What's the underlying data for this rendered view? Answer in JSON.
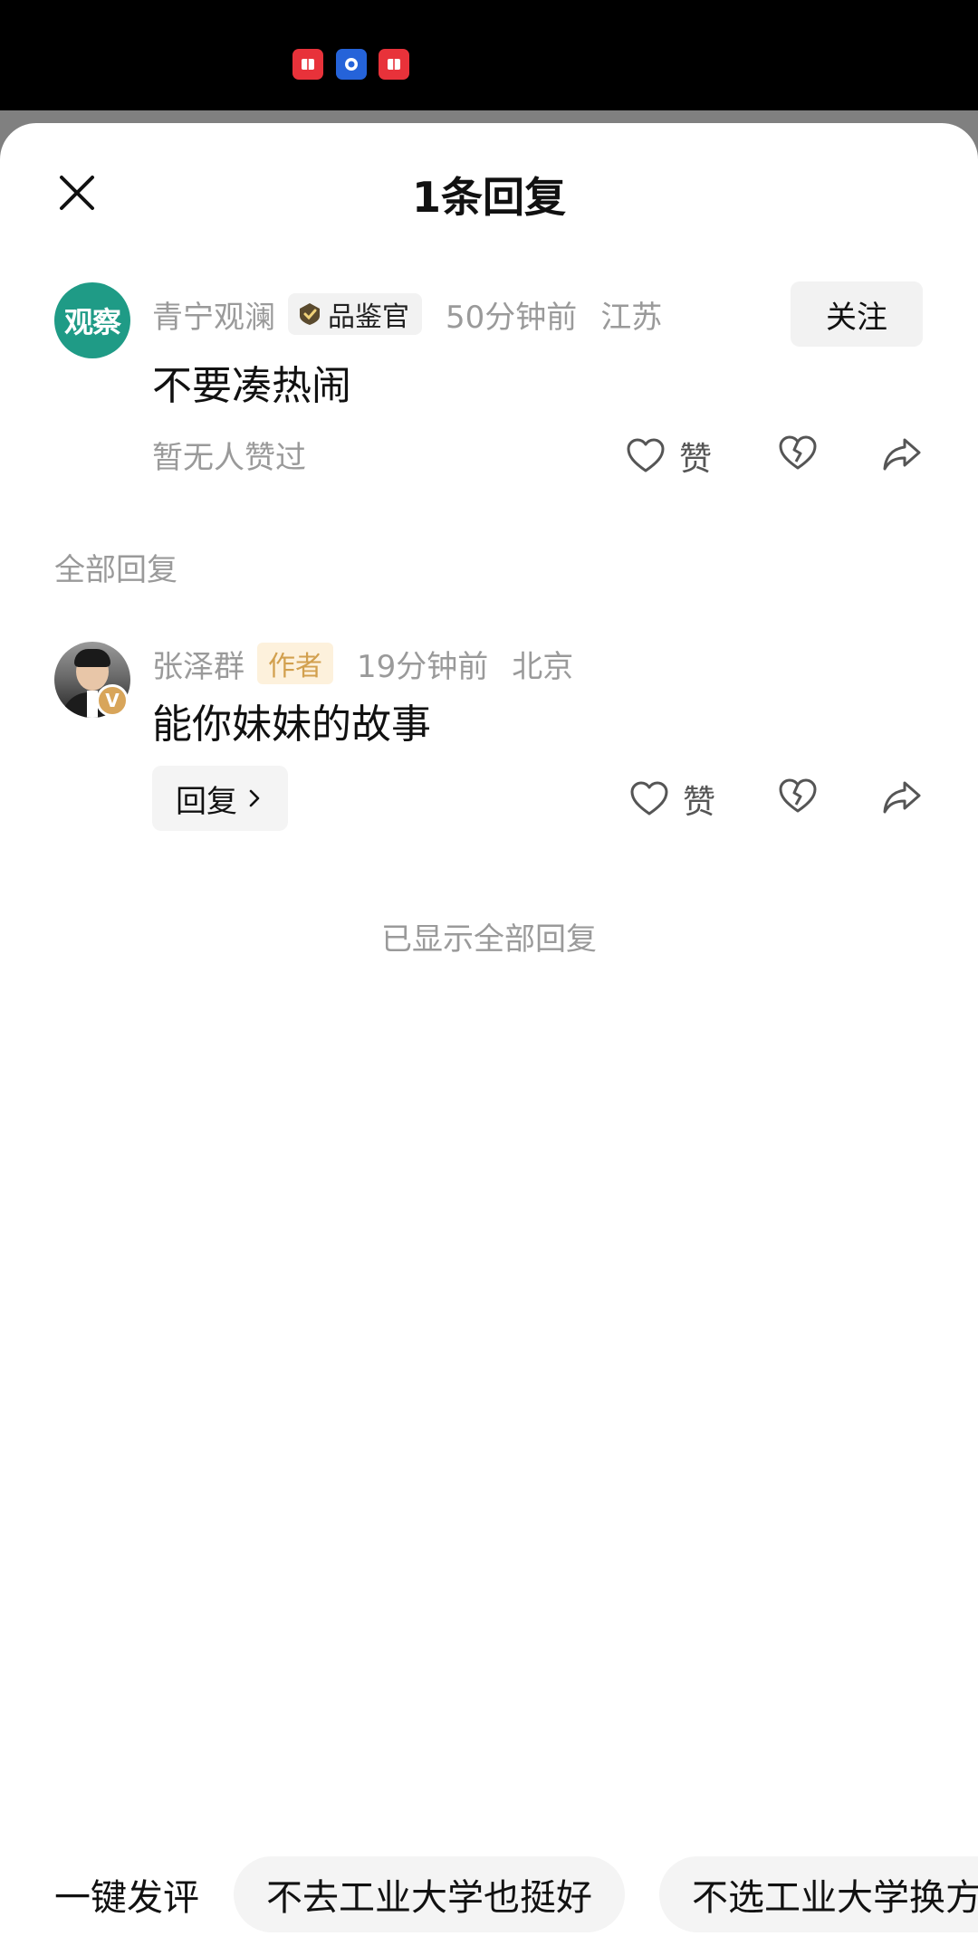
{
  "status_bar": {
    "icons": [
      "red-book-app-icon",
      "blue-app-icon",
      "red-book-app-icon"
    ],
    "colors": {
      "red": "#e8323a",
      "blue": "#2563d9"
    }
  },
  "sheet": {
    "title": "1条回复",
    "close_icon": "close-icon"
  },
  "main_comment": {
    "avatar_text": "观察",
    "username": "青宁观澜",
    "badge": "品鉴官",
    "time": "50分钟前",
    "location": "江苏",
    "follow_label": "关注",
    "text": "不要凑热闹",
    "likes_text": "暂无人赞过",
    "like_label": "赞"
  },
  "replies_section": {
    "label": "全部回复",
    "replies": [
      {
        "username": "张泽群",
        "role_badge": "作者",
        "verified_badge": "V",
        "time": "19分钟前",
        "location": "北京",
        "text": "能你妹妹的故事",
        "reply_label": "回复",
        "like_label": "赞"
      }
    ],
    "end_text": "已显示全部回复"
  },
  "quick_comment": {
    "label": "一键发评",
    "chips": [
      "不去工业大学也挺好",
      "不选工业大学换方"
    ]
  },
  "colors": {
    "avatar_green": "#1f9b86",
    "author_badge_bg": "#fdf1dc",
    "author_badge_text": "#d2a04e",
    "verified_gold": "#d8a55a"
  }
}
